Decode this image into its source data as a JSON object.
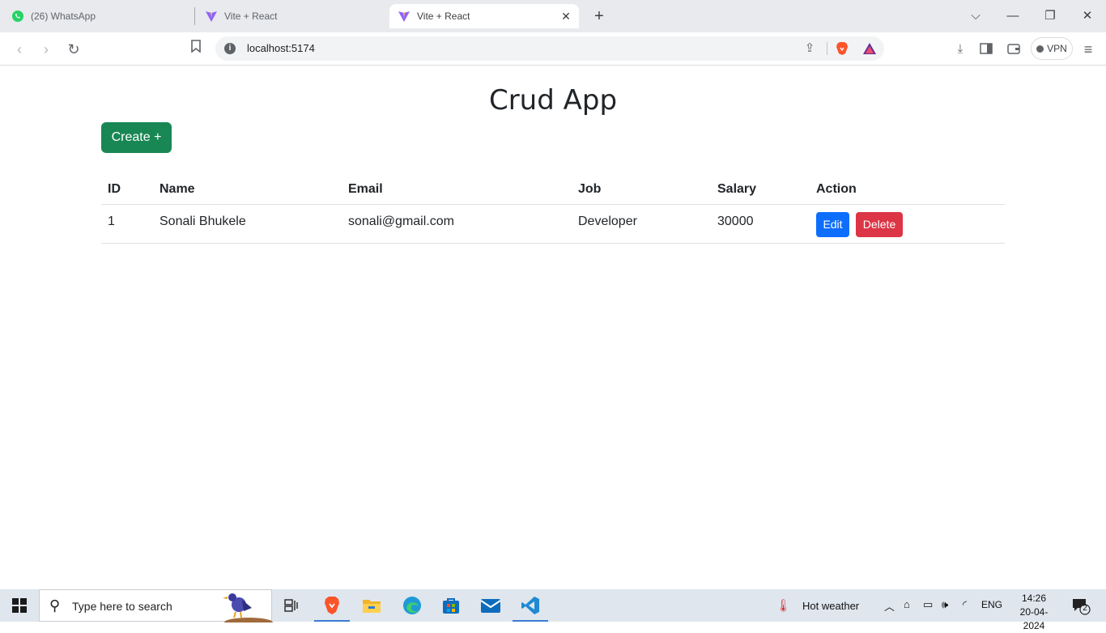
{
  "browser": {
    "tabs": [
      {
        "label": "(26) WhatsApp",
        "icon": "whatsapp-icon"
      },
      {
        "label": "Vite + React",
        "icon": "vite-icon"
      },
      {
        "label": "Vite + React",
        "icon": "vite-icon",
        "active": true
      }
    ],
    "url": "localhost:5174",
    "vpn_label": "VPN"
  },
  "app": {
    "title": "Crud App",
    "create_label": "Create +",
    "table": {
      "headers": [
        "ID",
        "Name",
        "Email",
        "Job",
        "Salary",
        "Action"
      ],
      "rows": [
        {
          "id": "1",
          "name": "Sonali Bhukele",
          "email": "sonali@gmail.com",
          "job": "Developer",
          "salary": "30000"
        }
      ],
      "edit_label": "Edit",
      "delete_label": "Delete"
    },
    "colors": {
      "create": "#198754",
      "edit": "#0d6efd",
      "delete": "#dc3545"
    }
  },
  "taskbar": {
    "search_placeholder": "Type here to search",
    "weather": "Hot weather",
    "language": "ENG",
    "time": "14:26",
    "date": "20-04-2024",
    "notification_count": "2"
  }
}
